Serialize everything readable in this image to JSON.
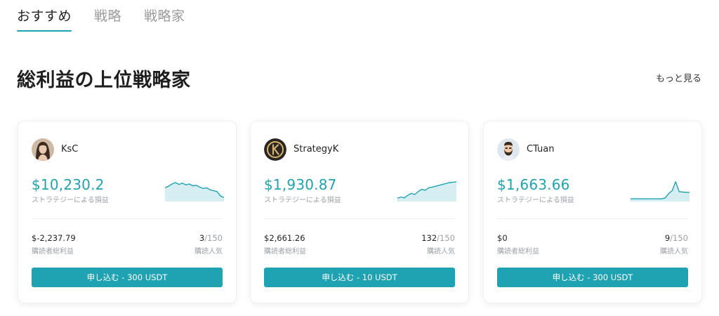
{
  "tabs": [
    {
      "label": "おすすめ",
      "active": true
    },
    {
      "label": "戦略",
      "active": false
    },
    {
      "label": "戦略家",
      "active": false
    }
  ],
  "section": {
    "title": "総利益の上位戦略家",
    "more_label": "もっと見る"
  },
  "colors": {
    "accent": "#1fa3b3",
    "sparkline_fill": "#d6eef1"
  },
  "cards": [
    {
      "trader_name": "KsC",
      "avatar_icon": "woman-portrait-avatar",
      "pnl": "$10,230.2",
      "pnl_label": "ストラテジーによる損益",
      "subscriber_profit": "$-2,237.79",
      "subscriber_profit_label": "購読者総利益",
      "subscribers": "3",
      "subscribers_max": "/150",
      "popularity_label": "購読人気",
      "button_label": "申し込む - 300 USDT",
      "sparkline": [
        0.55,
        0.62,
        0.72,
        0.78,
        0.7,
        0.76,
        0.68,
        0.72,
        0.64,
        0.66,
        0.58,
        0.52,
        0.55,
        0.46,
        0.42,
        0.38,
        0.18,
        0.12
      ]
    },
    {
      "trader_name": "StrategyK",
      "avatar_icon": "letter-k-logo-avatar",
      "pnl": "$1,930.87",
      "pnl_label": "ストラテジーによる損益",
      "subscriber_profit": "$2,661.26",
      "subscriber_profit_label": "購読者総利益",
      "subscribers": "132",
      "subscribers_max": "/150",
      "popularity_label": "購読人気",
      "button_label": "申し込む - 10 USDT",
      "sparkline": [
        0.08,
        0.14,
        0.1,
        0.22,
        0.3,
        0.25,
        0.38,
        0.48,
        0.44,
        0.55,
        0.58,
        0.62,
        0.66,
        0.7,
        0.74,
        0.78,
        0.8,
        0.82
      ]
    },
    {
      "trader_name": "CTuan",
      "avatar_icon": "bearded-man-avatar",
      "pnl": "$1,663.66",
      "pnl_label": "ストラテジーによる損益",
      "subscriber_profit": "$0",
      "subscriber_profit_label": "購読者総利益",
      "subscribers": "9",
      "subscribers_max": "/150",
      "popularity_label": "購読人気",
      "button_label": "申し込む - 300 USDT",
      "sparkline": [
        0.06,
        0.06,
        0.06,
        0.06,
        0.06,
        0.06,
        0.06,
        0.06,
        0.06,
        0.06,
        0.1,
        0.3,
        0.42,
        0.82,
        0.38,
        0.36,
        0.35,
        0.34
      ]
    }
  ]
}
